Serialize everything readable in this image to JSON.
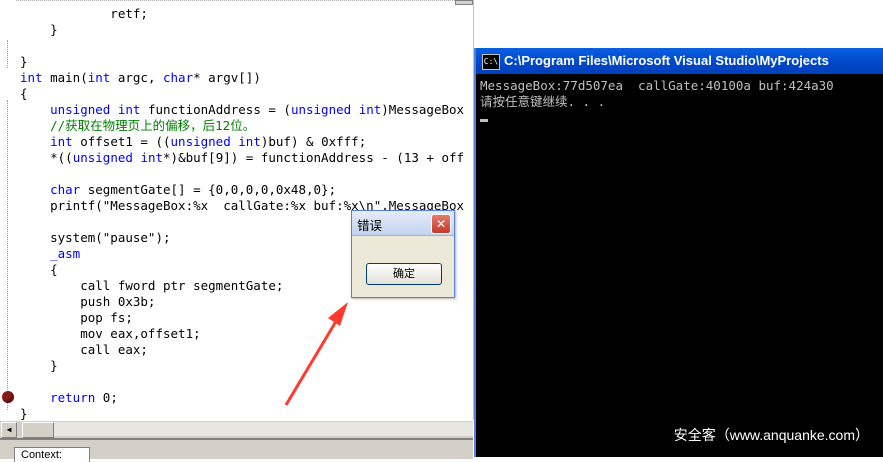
{
  "editor": {
    "lines": [
      {
        "parts": [
          {
            "t": "            retf;",
            "c": ""
          }
        ]
      },
      {
        "parts": [
          {
            "t": "    }",
            "c": ""
          }
        ]
      },
      {
        "parts": [
          {
            "t": "",
            "c": ""
          }
        ]
      },
      {
        "parts": [
          {
            "t": "}",
            "c": ""
          }
        ]
      },
      {
        "parts": [
          {
            "t": "int",
            "c": "kw"
          },
          {
            "t": " main(",
            "c": ""
          },
          {
            "t": "int",
            "c": "kw"
          },
          {
            "t": " argc, ",
            "c": ""
          },
          {
            "t": "char",
            "c": "kw"
          },
          {
            "t": "* argv[])",
            "c": ""
          }
        ]
      },
      {
        "parts": [
          {
            "t": "{",
            "c": ""
          }
        ]
      },
      {
        "parts": [
          {
            "t": "    ",
            "c": ""
          },
          {
            "t": "unsigned",
            "c": "kw"
          },
          {
            "t": " ",
            "c": ""
          },
          {
            "t": "int",
            "c": "kw"
          },
          {
            "t": " functionAddress = (",
            "c": ""
          },
          {
            "t": "unsigned",
            "c": "kw"
          },
          {
            "t": " ",
            "c": ""
          },
          {
            "t": "int",
            "c": "kw"
          },
          {
            "t": ")MessageBox",
            "c": ""
          }
        ]
      },
      {
        "parts": [
          {
            "t": "    //获取在物理页上的偏移，后12位。",
            "c": "cm"
          }
        ]
      },
      {
        "parts": [
          {
            "t": "    ",
            "c": ""
          },
          {
            "t": "int",
            "c": "kw"
          },
          {
            "t": " offset1 = ((",
            "c": ""
          },
          {
            "t": "unsigned",
            "c": "kw"
          },
          {
            "t": " ",
            "c": ""
          },
          {
            "t": "int",
            "c": "kw"
          },
          {
            "t": ")buf) & 0xfff;",
            "c": ""
          }
        ]
      },
      {
        "parts": [
          {
            "t": "    *((",
            "c": ""
          },
          {
            "t": "unsigned",
            "c": "kw"
          },
          {
            "t": " ",
            "c": ""
          },
          {
            "t": "int",
            "c": "kw"
          },
          {
            "t": "*)&buf[9]) = functionAddress - (13 + off",
            "c": ""
          }
        ]
      },
      {
        "parts": [
          {
            "t": "",
            "c": ""
          }
        ]
      },
      {
        "parts": [
          {
            "t": "    ",
            "c": ""
          },
          {
            "t": "char",
            "c": "kw"
          },
          {
            "t": " segmentGate[] = {0,0,0,0,0x48,0};",
            "c": ""
          }
        ]
      },
      {
        "parts": [
          {
            "t": "    printf(\"MessageBox:%x  callGate:%x buf:%x\\n\",MessageBox",
            "c": ""
          }
        ]
      },
      {
        "parts": [
          {
            "t": "",
            "c": ""
          }
        ]
      },
      {
        "parts": [
          {
            "t": "    system(\"pause\");",
            "c": ""
          }
        ]
      },
      {
        "parts": [
          {
            "t": "    ",
            "c": ""
          },
          {
            "t": "_asm",
            "c": "kw"
          }
        ]
      },
      {
        "parts": [
          {
            "t": "    {",
            "c": ""
          }
        ]
      },
      {
        "parts": [
          {
            "t": "        call fword ptr segmentGate;",
            "c": ""
          }
        ]
      },
      {
        "parts": [
          {
            "t": "        push 0x3b;",
            "c": ""
          }
        ]
      },
      {
        "parts": [
          {
            "t": "        pop fs;",
            "c": ""
          }
        ]
      },
      {
        "parts": [
          {
            "t": "        mov eax,offset1;",
            "c": ""
          }
        ]
      },
      {
        "parts": [
          {
            "t": "        call eax;",
            "c": ""
          }
        ]
      },
      {
        "parts": [
          {
            "t": "    }",
            "c": ""
          }
        ]
      },
      {
        "parts": [
          {
            "t": "",
            "c": ""
          }
        ]
      },
      {
        "parts": [
          {
            "t": "    ",
            "c": ""
          },
          {
            "t": "return",
            "c": "kw"
          },
          {
            "t": " 0;",
            "c": ""
          }
        ]
      },
      {
        "parts": [
          {
            "t": "}",
            "c": ""
          }
        ]
      }
    ],
    "lower_tab_label": "Context:"
  },
  "console": {
    "title": "C:\\Program Files\\Microsoft Visual Studio\\MyProjects",
    "icon_text": "C:\\",
    "output_line1": "MessageBox:77d507ea  callGate:40100a buf:424a30",
    "output_line2": "请按任意键继续. . ."
  },
  "dialog": {
    "title": "错误",
    "close_glyph": "✕",
    "ok_label": "确定"
  },
  "watermark": "安全客（www.anquanke.com）",
  "colors": {
    "keyword": "#0000ff",
    "comment": "#008000",
    "console_bg": "#000000",
    "title_blue": "#0047c9",
    "arrow": "#ff3b30",
    "breakpoint": "#8b1a1a"
  }
}
